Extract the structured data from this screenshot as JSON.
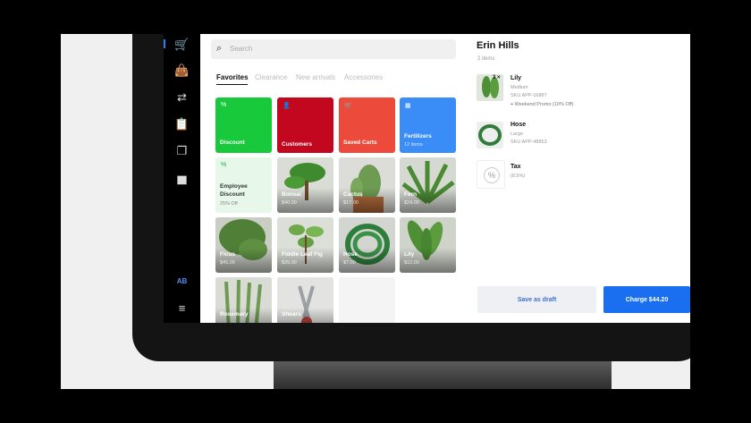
{
  "nav": {
    "items": [
      {
        "icon": "cart-icon",
        "glyph": "🛒"
      },
      {
        "icon": "bag-icon",
        "glyph": "👜"
      },
      {
        "icon": "transfer-icon",
        "glyph": "⇄"
      },
      {
        "icon": "clipboard-icon",
        "glyph": "📋"
      },
      {
        "icon": "layers-icon",
        "glyph": "❐"
      },
      {
        "icon": "bar-chart-icon",
        "glyph": "▅"
      }
    ],
    "user_initials": "AB",
    "menu_glyph": "≡"
  },
  "search": {
    "placeholder": "Search"
  },
  "tabs": [
    {
      "label": "Favorites",
      "active": true
    },
    {
      "label": "Clearance",
      "active": false
    },
    {
      "label": "New arrivals",
      "active": false
    },
    {
      "label": "Accessories",
      "active": false
    }
  ],
  "tiles": [
    {
      "kind": "action",
      "label": "Discount",
      "icon": "%",
      "color": "#19c93c"
    },
    {
      "kind": "action",
      "label": "Customers",
      "icon": "👤",
      "color": "#c2071f"
    },
    {
      "kind": "action",
      "label": "Saved Carts",
      "icon": "🛒",
      "color": "#ec4a3b"
    },
    {
      "kind": "action",
      "label": "Fertilizers",
      "sub": "12 items",
      "icon": "▦",
      "color": "#3a8cf7"
    },
    {
      "kind": "light",
      "label": "Employee Discount",
      "sub": "25% Off",
      "icon": "%",
      "color": "#e7f8ea"
    },
    {
      "kind": "plant",
      "label": "Bonsai",
      "price": "$40.00"
    },
    {
      "kind": "plant",
      "label": "Cactus",
      "price": "$17.00"
    },
    {
      "kind": "plant",
      "label": "Fern",
      "price": "$24.00"
    },
    {
      "kind": "plant",
      "label": "Ficus",
      "price": "$45.00"
    },
    {
      "kind": "plant",
      "label": "Fiddle Leaf Fig",
      "price": "$35.00"
    },
    {
      "kind": "plant",
      "label": "Hose",
      "price": "$7.00"
    },
    {
      "kind": "plant",
      "label": "Lily",
      "price": "$12.00"
    },
    {
      "kind": "plant",
      "label": "Rosemary",
      "price": ""
    },
    {
      "kind": "plant",
      "label": "Shears",
      "price": ""
    }
  ],
  "cart": {
    "customer": "Erin Hills",
    "item_count": "2 items",
    "items": [
      {
        "name": "Lily",
        "qty": "3 ×",
        "size": "Medium",
        "sku": "SKU APP-16887",
        "promo": "Weekend Promo (10% Off)"
      },
      {
        "name": "Hose",
        "size": "Large",
        "sku": "SKU APP-48853"
      }
    ],
    "tax": {
      "name": "Tax",
      "rate": "(8.5%)"
    },
    "save_label": "Save as draft",
    "charge_label": "Charge $44.20"
  },
  "colors": {
    "accent": "#1a6ef0"
  }
}
